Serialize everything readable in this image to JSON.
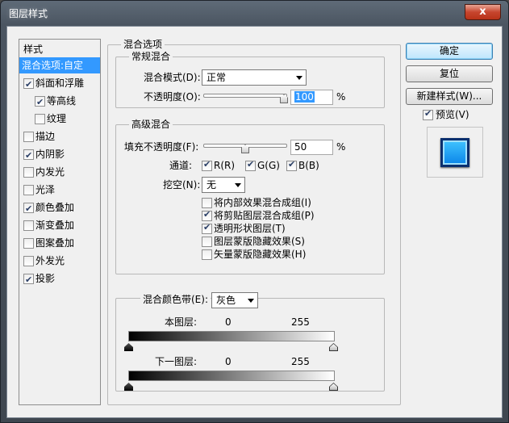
{
  "window": {
    "title": "图层样式",
    "close_label": "x"
  },
  "style_list": {
    "header": "样式",
    "selected": "混合选项:自定",
    "items": [
      {
        "label": "斜面和浮雕",
        "checked": true,
        "indent": 0
      },
      {
        "label": "等高线",
        "checked": true,
        "indent": 1
      },
      {
        "label": "纹理",
        "checked": false,
        "indent": 1
      },
      {
        "label": "描边",
        "checked": false,
        "indent": 0
      },
      {
        "label": "内阴影",
        "checked": true,
        "indent": 0
      },
      {
        "label": "内发光",
        "checked": false,
        "indent": 0
      },
      {
        "label": "光泽",
        "checked": false,
        "indent": 0
      },
      {
        "label": "颜色叠加",
        "checked": true,
        "indent": 0
      },
      {
        "label": "渐变叠加",
        "checked": false,
        "indent": 0
      },
      {
        "label": "图案叠加",
        "checked": false,
        "indent": 0
      },
      {
        "label": "外发光",
        "checked": false,
        "indent": 0
      },
      {
        "label": "投影",
        "checked": true,
        "indent": 0
      }
    ]
  },
  "blend_options": {
    "title": "混合选项",
    "general": {
      "title": "常规混合",
      "blend_mode_label": "混合模式(D):",
      "blend_mode_value": "正常",
      "opacity_label": "不透明度(O):",
      "opacity_value": "100",
      "opacity_unit": "%",
      "opacity_level": 100
    },
    "advanced": {
      "title": "高级混合",
      "fill_opacity_label": "填充不透明度(F):",
      "fill_opacity_value": "50",
      "fill_opacity_unit": "%",
      "fill_opacity_level": 50,
      "channels_label": "通道:",
      "channel_r": "R(R)",
      "channel_g": "G(G)",
      "channel_b": "B(B)",
      "knockout_label": "挖空(N):",
      "knockout_value": "无",
      "options": [
        {
          "label": "将内部效果混合成组(I)",
          "checked": false
        },
        {
          "label": "将剪贴图层混合成组(P)",
          "checked": true
        },
        {
          "label": "透明形状图层(T)",
          "checked": true
        },
        {
          "label": "图层蒙版隐藏效果(S)",
          "checked": false
        },
        {
          "label": "矢量蒙版隐藏效果(H)",
          "checked": false
        }
      ]
    },
    "blend_if": {
      "label": "混合颜色带(E):",
      "value": "灰色",
      "this_layer_label": "本图层:",
      "this_layer_min": "0",
      "this_layer_max": "255",
      "underlying_label": "下一图层:",
      "underlying_min": "0",
      "underlying_max": "255"
    }
  },
  "buttons": {
    "ok": "确定",
    "reset": "复位",
    "new_style": "新建样式(W)...",
    "preview_label": "预览(V)",
    "preview_checked": true
  },
  "colors": {
    "selection": "#3399ff",
    "preview_fill": "#1a9cf5"
  }
}
